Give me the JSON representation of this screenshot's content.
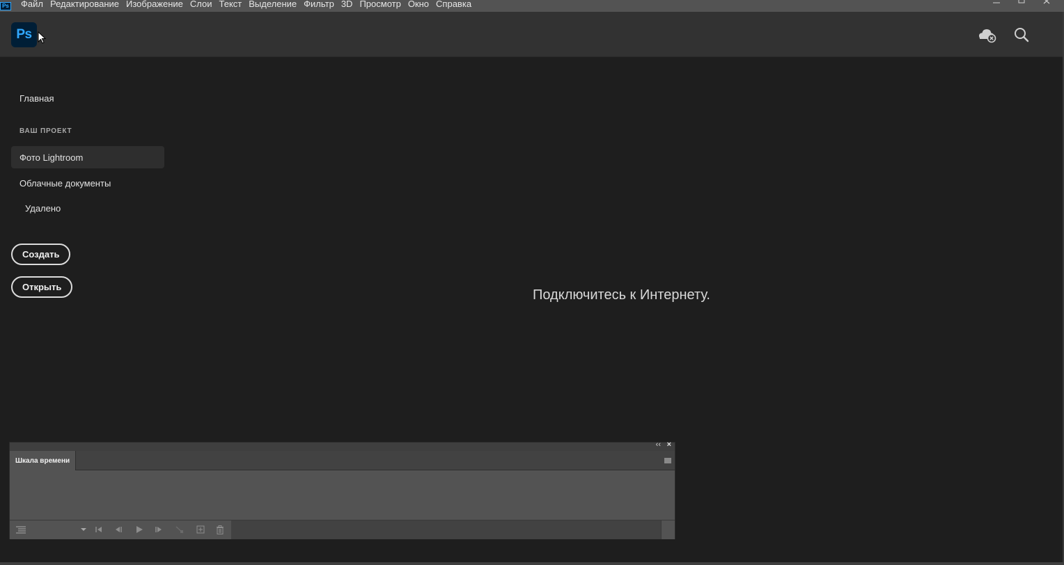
{
  "menubar": {
    "app_icon_label": "Ps",
    "items": [
      "Файл",
      "Редактирование",
      "Изображение",
      "Слои",
      "Текст",
      "Выделение",
      "Фильтр",
      "3D",
      "Просмотр",
      "Окно",
      "Справка"
    ],
    "window_controls": [
      "minimize-icon",
      "maximize-icon",
      "close-icon"
    ]
  },
  "header": {
    "logo_label": "Ps",
    "icons": [
      "cloud-offline-icon",
      "search-icon"
    ]
  },
  "sidebar": {
    "home": "Главная",
    "section_label": "ВАШ ПРОЕКТ",
    "items": [
      {
        "label": "Фото Lightroom",
        "active": true
      },
      {
        "label": "Облачные документы",
        "active": false
      },
      {
        "label": "Удалено",
        "active": false
      }
    ],
    "create_label": "Создать",
    "open_label": "Открыть"
  },
  "main": {
    "message": "Подключитесь к Интернету."
  },
  "timeline": {
    "tab_label": "Шкала времени",
    "collapse_glyph": "‹‹",
    "close_glyph": "×"
  },
  "colors": {
    "app_bg": "#1e1e1e",
    "header_bg": "#323232",
    "menubar_bg": "#535353",
    "ps_blue": "#31a8ff",
    "ps_dark": "#001e36",
    "panel_bg": "#535353"
  }
}
